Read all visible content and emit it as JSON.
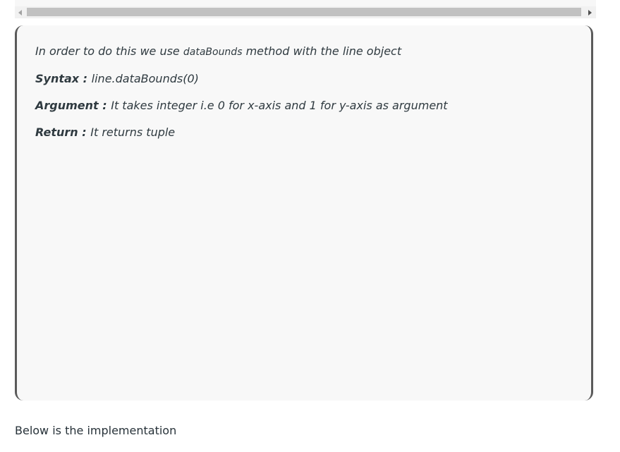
{
  "scrollbar": {
    "left_arrow_icon": "triangle-left-icon",
    "right_arrow_icon": "triangle-right-icon"
  },
  "note": {
    "line1_prefix": "In order to do this we use ",
    "line1_code": "dataBounds",
    "line1_suffix": " method with the line object",
    "syntax_label": "Syntax : ",
    "syntax_value": "line.dataBounds(0)",
    "argument_label": "Argument : ",
    "argument_value": "It takes integer i.e 0 for x-axis and 1 for y-axis as argument",
    "return_label": "Return : ",
    "return_value": "It returns tuple"
  },
  "body_text": "Below is the implementation",
  "colors": {
    "quote_border": "#5a5a5a",
    "quote_background": "#f8f8f8",
    "scroll_thumb": "#c1c1c1"
  }
}
